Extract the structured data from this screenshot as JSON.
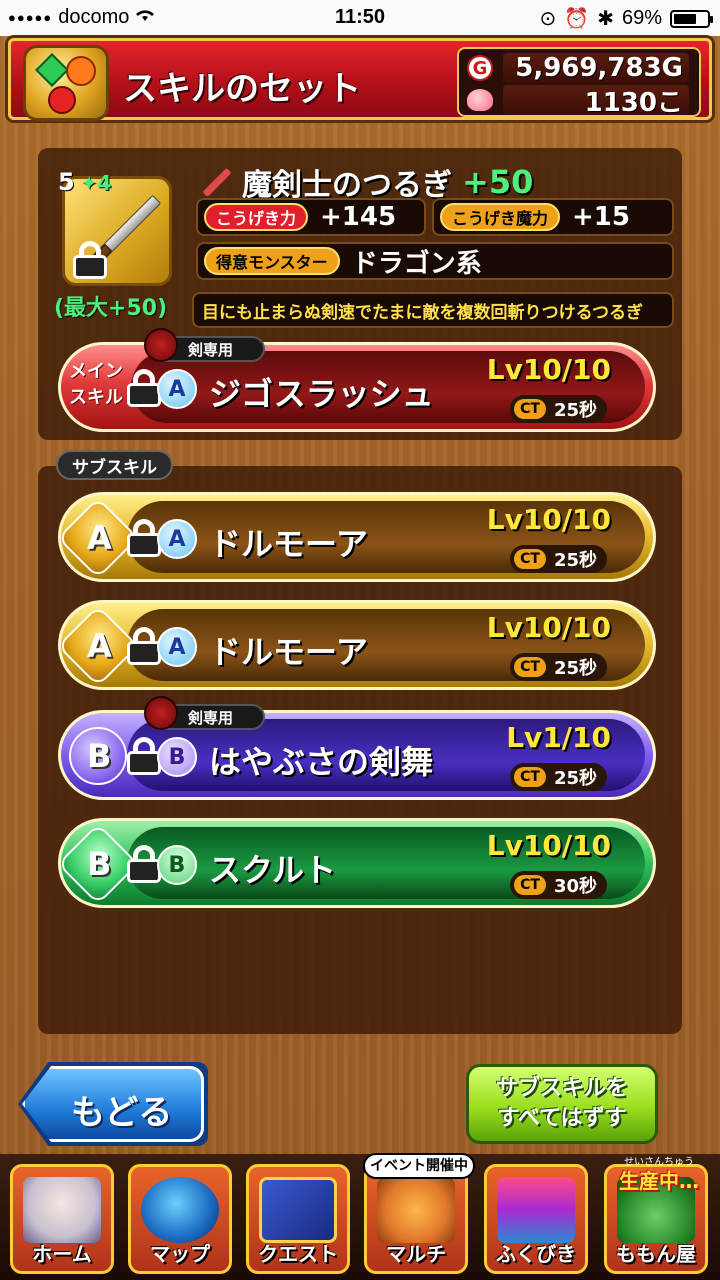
{
  "status_bar": {
    "carrier": "docomo",
    "time": "11:50",
    "battery": "69%",
    "battery_level": 0.69
  },
  "header": {
    "title": "スキルのセット",
    "gold": "5,969,783G",
    "gems": "1130こ"
  },
  "weapon": {
    "stars": "5",
    "plus_stars": "✦4",
    "name": "魔剣士のつるぎ",
    "plus": "+50",
    "max_label": "(最大+50)",
    "attack_label": "こうげき力",
    "attack_value": "+145",
    "magic_label": "こうげき魔力",
    "magic_value": "+15",
    "monster_label": "得意モンスター",
    "monster_value": "ドラゴン系",
    "description": "目にも止まらぬ剣速でたまに敵を複数回斬りつけるつるぎ"
  },
  "main_skill": {
    "label_line1": "メイン",
    "label_line2": "スキル",
    "tag": "剣専用",
    "rank": "A",
    "name": "ジゴスラッシュ",
    "level": "Lv10/10",
    "ct_label": "CT",
    "ct": "25秒"
  },
  "sub_skills_title": "サブスキル",
  "sub_skills": [
    {
      "slot": "A",
      "rank": "A",
      "name": "ドルモーア",
      "level": "Lv10/10",
      "ct_label": "CT",
      "ct": "25秒",
      "color": "#e4b82a"
    },
    {
      "slot": "A",
      "rank": "A",
      "name": "ドルモーア",
      "level": "Lv10/10",
      "ct_label": "CT",
      "ct": "25秒",
      "color": "#e4b82a"
    },
    {
      "slot": "B",
      "rank": "B",
      "tag": "剣専用",
      "name": "はやぶさの剣舞",
      "level": "Lv1/10",
      "ct_label": "CT",
      "ct": "25秒",
      "color": "#7e5ef0"
    },
    {
      "slot": "B",
      "rank": "B",
      "name": "スクルト",
      "level": "Lv10/10",
      "ct_label": "CT",
      "ct": "30秒",
      "color": "#2ec05a"
    }
  ],
  "buttons": {
    "back": "もどる",
    "remove_all_line1": "サブスキルを",
    "remove_all_line2": "すべてはずす"
  },
  "tabs": [
    {
      "label": "ホーム",
      "icon": "home-icon"
    },
    {
      "label": "マップ",
      "icon": "map-icon"
    },
    {
      "label": "クエスト",
      "icon": "quest-icon"
    },
    {
      "label": "マルチ",
      "icon": "multi-icon",
      "banner": "イベント開催中"
    },
    {
      "label": "ふくびき",
      "icon": "lottery-icon"
    },
    {
      "label": "ももん屋",
      "icon": "shop-icon",
      "banner": "生産中…",
      "sub_banner": "せいさんちゅう"
    }
  ]
}
